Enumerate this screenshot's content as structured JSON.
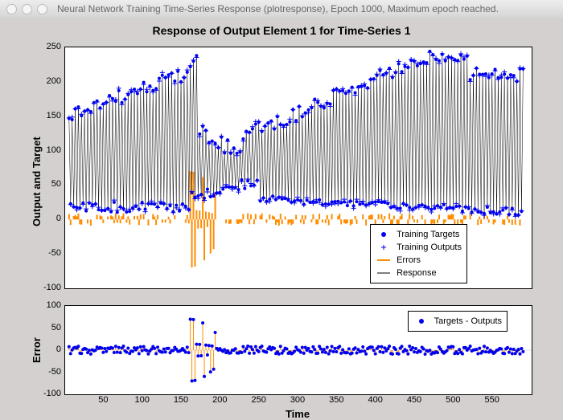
{
  "window": {
    "title": "Neural Network Training Time-Series Response (plotresponse), Epoch 1000, Maximum epoch reached."
  },
  "chart_data": [
    {
      "type": "line",
      "title": "Response of Output Element 1 for Time-Series 1",
      "xlabel": "Time",
      "ylabel": "Output and Target",
      "xlim": [
        0,
        600
      ],
      "ylim": [
        -100,
        250
      ],
      "xticks": [
        50,
        100,
        150,
        200,
        250,
        300,
        350,
        400,
        450,
        500,
        550
      ],
      "yticks": [
        -100,
        -50,
        0,
        50,
        100,
        150,
        200,
        250
      ],
      "legend": [
        "Training Targets",
        "Training Outputs",
        "Errors",
        "Response"
      ],
      "series": [
        {
          "name": "Training Targets",
          "style": "blue-dot"
        },
        {
          "name": "Training Outputs",
          "style": "blue-plus"
        },
        {
          "name": "Errors",
          "style": "orange-line"
        },
        {
          "name": "Response",
          "style": "black-line"
        }
      ],
      "note": "Dense oscillatory time series ~600 samples; response amplitude varies roughly 0–240 with a dip near t≈175–250 and peaks near t≈160 and t≈480–520. Targets and outputs overlap heavily; errors are small except short spikes near t≈165–190."
    },
    {
      "type": "line",
      "xlabel": "Time",
      "ylabel": "Error",
      "xlim": [
        0,
        600
      ],
      "ylim": [
        -100,
        100
      ],
      "xticks": [
        50,
        100,
        150,
        200,
        250,
        300,
        350,
        400,
        450,
        500,
        550
      ],
      "yticks": [
        -100,
        -50,
        0,
        50,
        100
      ],
      "legend": [
        "Targets - Outputs"
      ],
      "series": [
        {
          "name": "Targets - Outputs",
          "style": "blue-dot-orange-stem"
        }
      ],
      "note": "Errors mostly within ±15; isolated spikes to about +70 / −80 around t≈165–190."
    }
  ]
}
